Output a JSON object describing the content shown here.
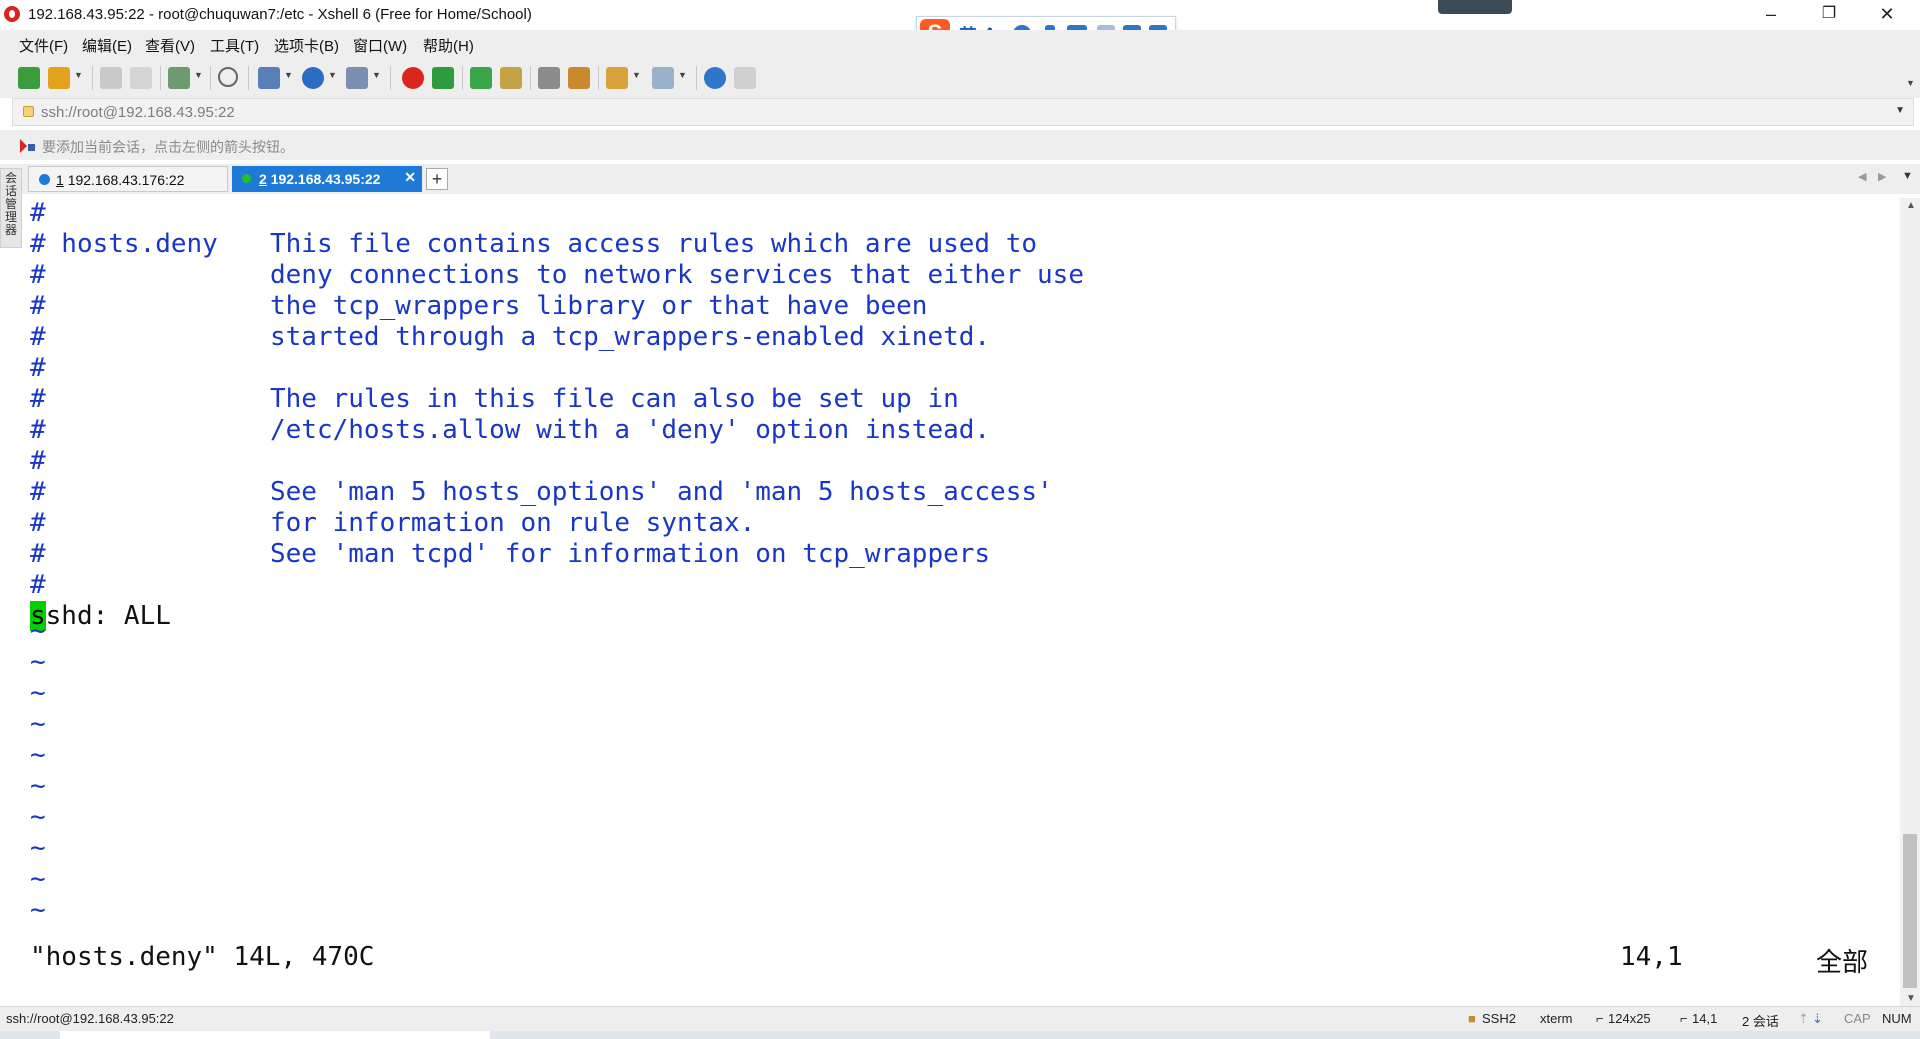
{
  "window": {
    "title": "192.168.43.95:22 - root@chuquwan7:/etc - Xshell 6 (Free for Home/School)",
    "controls": {
      "minimize": "–",
      "maximize": "❐",
      "close": "✕"
    }
  },
  "ime_toolbar": {
    "logo": "S",
    "mode": "英",
    "punct": "•,"
  },
  "menu": [
    "文件(F)",
    "编辑(E)",
    "查看(V)",
    "工具(T)",
    "选项卡(B)",
    "窗口(W)",
    "帮助(H)"
  ],
  "toolbar_icons": [
    "new-session-icon",
    "open-folder-icon",
    "reconnect-icon",
    "disconnect-icon",
    "properties-icon",
    "find-icon",
    "transfer-icon",
    "globe-icon",
    "font-icon",
    "xshell-icon",
    "xftp-icon",
    "fullscreen-icon",
    "lock-icon",
    "keyboard-icon",
    "highlight-icon",
    "script-icon",
    "layout-icon",
    "help-icon",
    "chat-icon"
  ],
  "address": {
    "value": "ssh://root@192.168.43.95:22"
  },
  "hint": {
    "text": "要添加当前会话，点击左侧的箭头按钮。"
  },
  "sidebar": {
    "label": "会话管理器"
  },
  "tabs": [
    {
      "num": "1",
      "label": "192.168.43.176:22",
      "status_color": "#1e7ad6",
      "active": false
    },
    {
      "num": "2",
      "label": "192.168.43.95:22",
      "status_color": "#22c12a",
      "active": true
    }
  ],
  "tab_add": "+",
  "terminal": {
    "lines": [
      {
        "hash": "#",
        "text": ""
      },
      {
        "hash": "# hosts.deny",
        "text": "This file contains access rules which are used to"
      },
      {
        "hash": "#",
        "text": "deny connections to network services that either use"
      },
      {
        "hash": "#",
        "text": "the tcp_wrappers library or that have been"
      },
      {
        "hash": "#",
        "text": "started through a tcp_wrappers-enabled xinetd."
      },
      {
        "hash": "#",
        "text": ""
      },
      {
        "hash": "#",
        "text": "The rules in this file can also be set up in"
      },
      {
        "hash": "#",
        "text": "/etc/hosts.allow with a 'deny' option instead."
      },
      {
        "hash": "#",
        "text": ""
      },
      {
        "hash": "#",
        "text": "See 'man 5 hosts_options' and 'man 5 hosts_access'"
      },
      {
        "hash": "#",
        "text": "for information on rule syntax."
      },
      {
        "hash": "#",
        "text": "See 'man tcpd' for information on tcp_wrappers"
      },
      {
        "hash": "#",
        "text": ""
      }
    ],
    "config_line": {
      "cursor_char": "s",
      "rest": "shd: ALL"
    },
    "tilde": "~",
    "status": {
      "file": "\"hosts.deny\" 14L, 470C",
      "position": "14,1",
      "scope": "全部"
    }
  },
  "statusbar": {
    "connection": "ssh://root@192.168.43.95:22",
    "protocol": "SSH2",
    "terminal_type": "xterm",
    "size": "124x25",
    "cursor": "14,1",
    "sessions": "2 会话",
    "caps": "CAP",
    "num": "NUM"
  }
}
